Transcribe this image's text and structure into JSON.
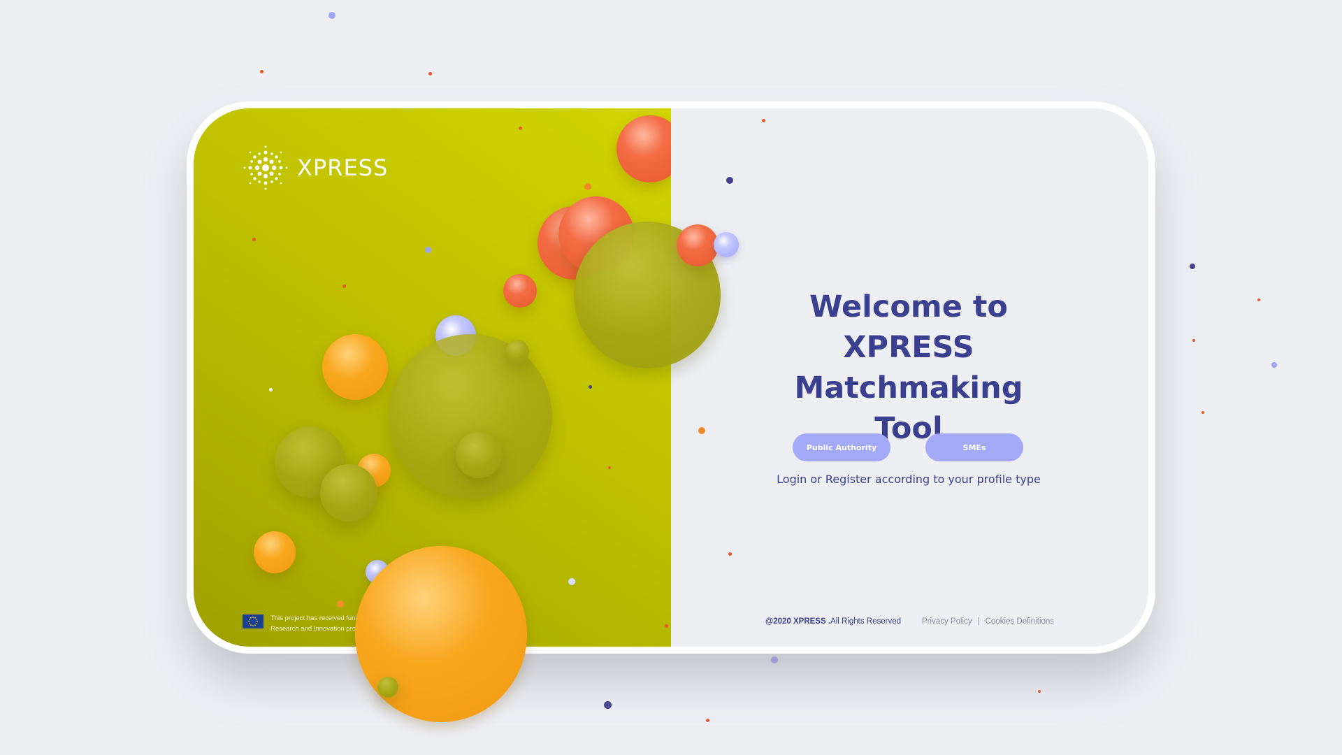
{
  "brand": {
    "logo_text": "XPRESS",
    "logo_icon": "xpress-dotted-sunburst-icon"
  },
  "funding": {
    "flag_icon": "eu-flag-icon",
    "text": "This project has received funding from the European Union's Horizon 2020 Research and Innovation programme under Grant Agreement No 857831"
  },
  "welcome": {
    "title_line1": "Welcome to XPRESS",
    "title_line2": "Matchmaking Tool",
    "subtitle": "Login or Register according to your profile type"
  },
  "buttons": {
    "public_authority": "Public Authority",
    "smes": "SMEs"
  },
  "footer": {
    "copyright_strong": "@2020 XPRESS .",
    "copyright_rest": " All Rights Reserved",
    "privacy": "Privacy Policy",
    "separator": "|",
    "cookies": "Cookies Definitions"
  },
  "colors": {
    "title": "#3a3f8f",
    "button": "#a3a9f6",
    "left_panel": "#bcbe00",
    "background": "#eeeff3"
  }
}
